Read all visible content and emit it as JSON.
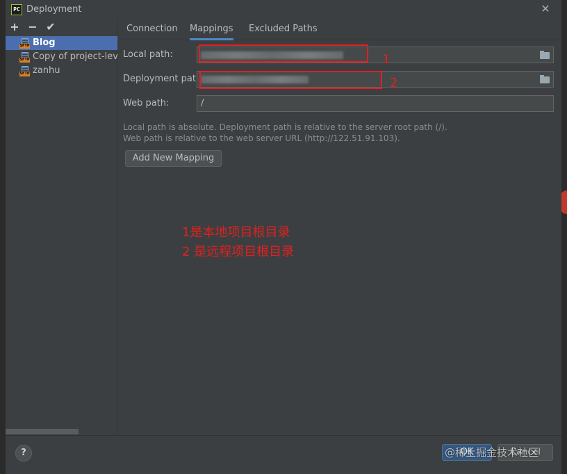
{
  "window": {
    "title": "Deployment",
    "app_badge": "PC"
  },
  "toolbar": {
    "add": "+",
    "remove": "−",
    "apply": "✔"
  },
  "servers": [
    {
      "label": "Blog",
      "badge": "SFTP",
      "selected": true
    },
    {
      "label": "Copy of project-level",
      "badge": "SFTP",
      "selected": false
    },
    {
      "label": "zanhu",
      "badge": "SFTP",
      "selected": false
    }
  ],
  "tabs": [
    "Connection",
    "Mappings",
    "Excluded Paths"
  ],
  "active_tab": "Mappings",
  "form": {
    "local_path_label": "Local path:",
    "local_path_value": "",
    "deployment_path_label": "Deployment path:",
    "deployment_path_value": "",
    "web_path_label": "Web path:",
    "web_path_value": "/"
  },
  "hint": {
    "line1": "Local path is absolute. Deployment path is relative to the server root path (/).",
    "line2": "Web path is relative to the web server URL (http://122.51.91.103)."
  },
  "add_mapping_label": "Add New Mapping",
  "annotations": {
    "marker1": "1",
    "marker2": "2",
    "note_line1": "1是本地项目根目录",
    "note_line2": "2 是远程项目根目录",
    "color": "#e02020"
  },
  "footer": {
    "help": "?",
    "ok": "OK",
    "cancel": "Cancel",
    "watermark": "@稀土掘金技术社区"
  },
  "colors": {
    "selection": "#4b6eaf",
    "tab_underline": "#4a88c7",
    "ok_button": "#365880"
  }
}
